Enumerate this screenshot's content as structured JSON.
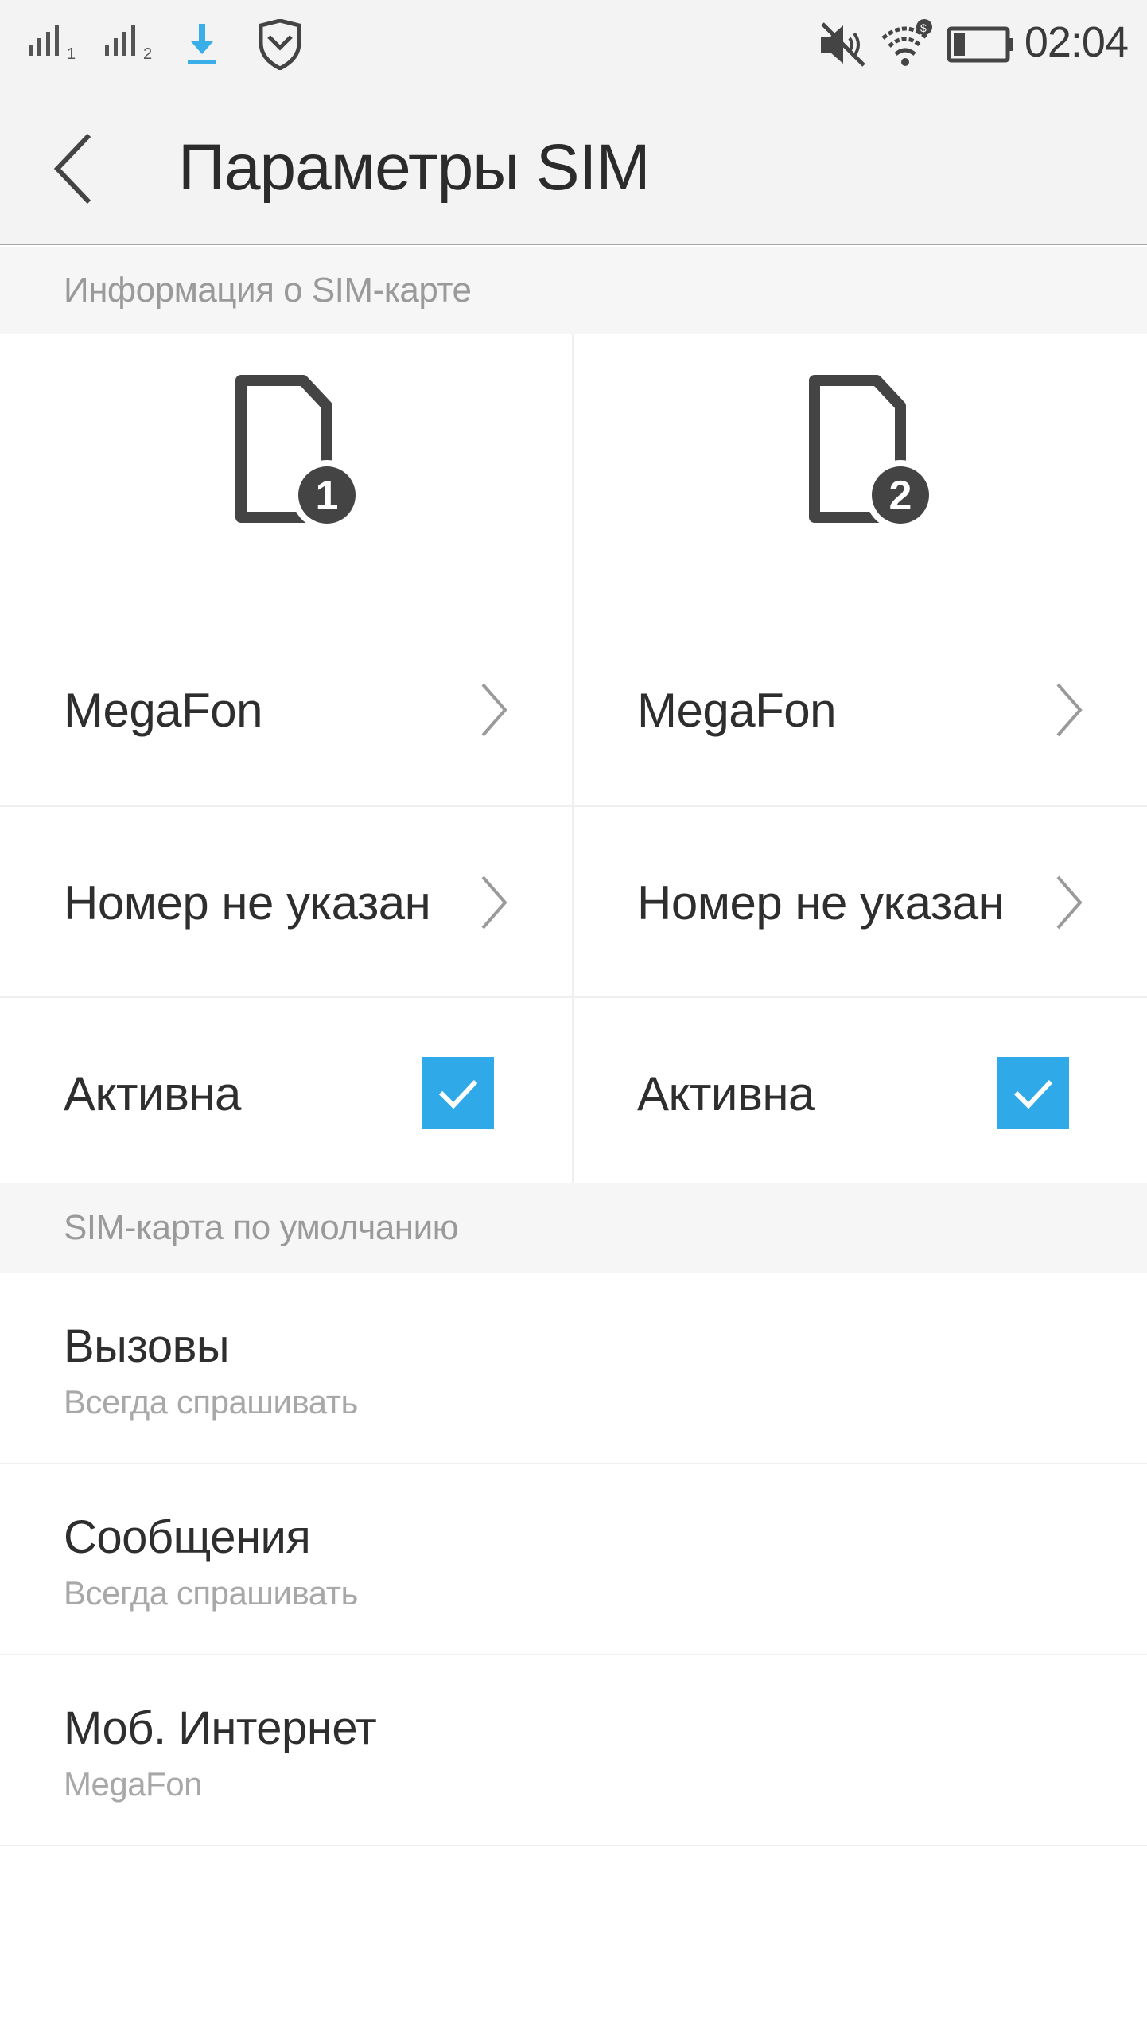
{
  "status_bar": {
    "clock": "02:04",
    "sim1_index": "1",
    "sim2_index": "2",
    "icons": [
      "signal-sim1-icon",
      "signal-sim2-icon",
      "download-icon",
      "shield-icon",
      "mute-icon",
      "wifi-icon",
      "battery-icon"
    ]
  },
  "header": {
    "title": "Параметры SIM"
  },
  "sim_info": {
    "section_label": "Информация о SIM-карте",
    "cards": [
      {
        "badge": "1",
        "operator": "MegaFon",
        "number": "Номер не указан",
        "active_label": "Активна",
        "active": true
      },
      {
        "badge": "2",
        "operator": "MegaFon",
        "number": "Номер не указан",
        "active_label": "Активна",
        "active": true
      }
    ]
  },
  "default_sim": {
    "section_label": "SIM-карта по умолчанию",
    "items": [
      {
        "title": "Вызовы",
        "value": "Всегда спрашивать"
      },
      {
        "title": "Сообщения",
        "value": "Всегда спрашивать"
      },
      {
        "title": "Моб. Интернет",
        "value": "MegaFon"
      }
    ]
  },
  "colors": {
    "accent": "#2fa9e8",
    "background": "#ffffff",
    "bar_background": "#f3f3f3",
    "section_background": "#f6f6f6",
    "icon_dark": "#444444"
  }
}
